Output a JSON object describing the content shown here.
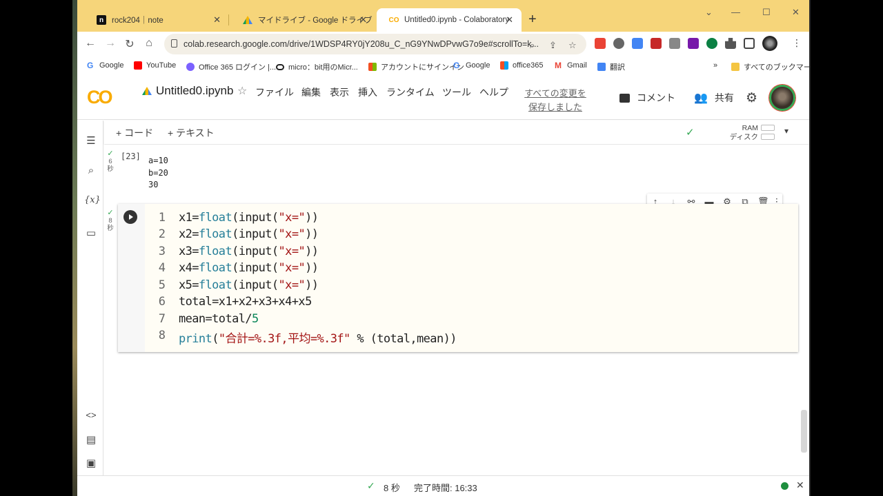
{
  "browser": {
    "tabs": [
      {
        "title": "rock204｜note",
        "favicon": "note-favicon",
        "active": false
      },
      {
        "title": "マイドライブ - Google ドライブ",
        "favicon": "google-drive-favicon",
        "active": false
      },
      {
        "title": "Untitled0.ipynb - Colaboratory",
        "favicon": "colab-favicon",
        "active": true
      }
    ],
    "new_tab": "+",
    "url": "colab.research.google.com/drive/1WDSP4RY0jY208u_C_nG9YNwDPvwG7o9e#scrollTo=k...",
    "bookmarks": [
      {
        "label": "Google",
        "color": "#4285f4"
      },
      {
        "label": "YouTube",
        "color": "#ff0000"
      },
      {
        "label": "Office 365 ログイン |...",
        "color": "#7b61ff"
      },
      {
        "label": "micro：bit用のMicr...",
        "color": "#222222"
      },
      {
        "label": "アカウントにサインイン",
        "color": "#f25022"
      },
      {
        "label": "Google",
        "color": "#4285f4"
      },
      {
        "label": "office365",
        "color": "#f25022"
      },
      {
        "label": "Gmail",
        "color": "#ea4335"
      },
      {
        "label": "翻訳",
        "color": "#4285f4"
      }
    ],
    "bookmarks_overflow": "»",
    "all_bookmarks": "すべてのブックマーク"
  },
  "colab": {
    "logo": "CO",
    "title": "Untitled0.ipynb",
    "menus": [
      "ファイル",
      "編集",
      "表示",
      "挿入",
      "ランタイム",
      "ツール",
      "ヘルプ"
    ],
    "saved_line1": "すべての変更を",
    "saved_line2": "保存しました",
    "comment": "コメント",
    "share": "共有",
    "add_code": "+ コード",
    "add_text": "+ テキスト",
    "ram": "RAM",
    "disk": "ディスク"
  },
  "output_cell": {
    "exec_time_value": "6",
    "exec_time_unit": "秒",
    "count": "[23]",
    "output": "a=10\nb=20\n30"
  },
  "code_cell": {
    "exec_time_value": "8",
    "exec_time_unit": "秒",
    "line_numbers": [
      "1",
      "2",
      "3",
      "4",
      "5",
      "6",
      "7",
      "8"
    ]
  },
  "status": {
    "duration": "8 秒",
    "completed": "完了時間: 16:33"
  },
  "colors": {
    "tabstrip": "#f6d57a",
    "colab_orange": "#f9ab00",
    "success_green": "#34a853"
  }
}
